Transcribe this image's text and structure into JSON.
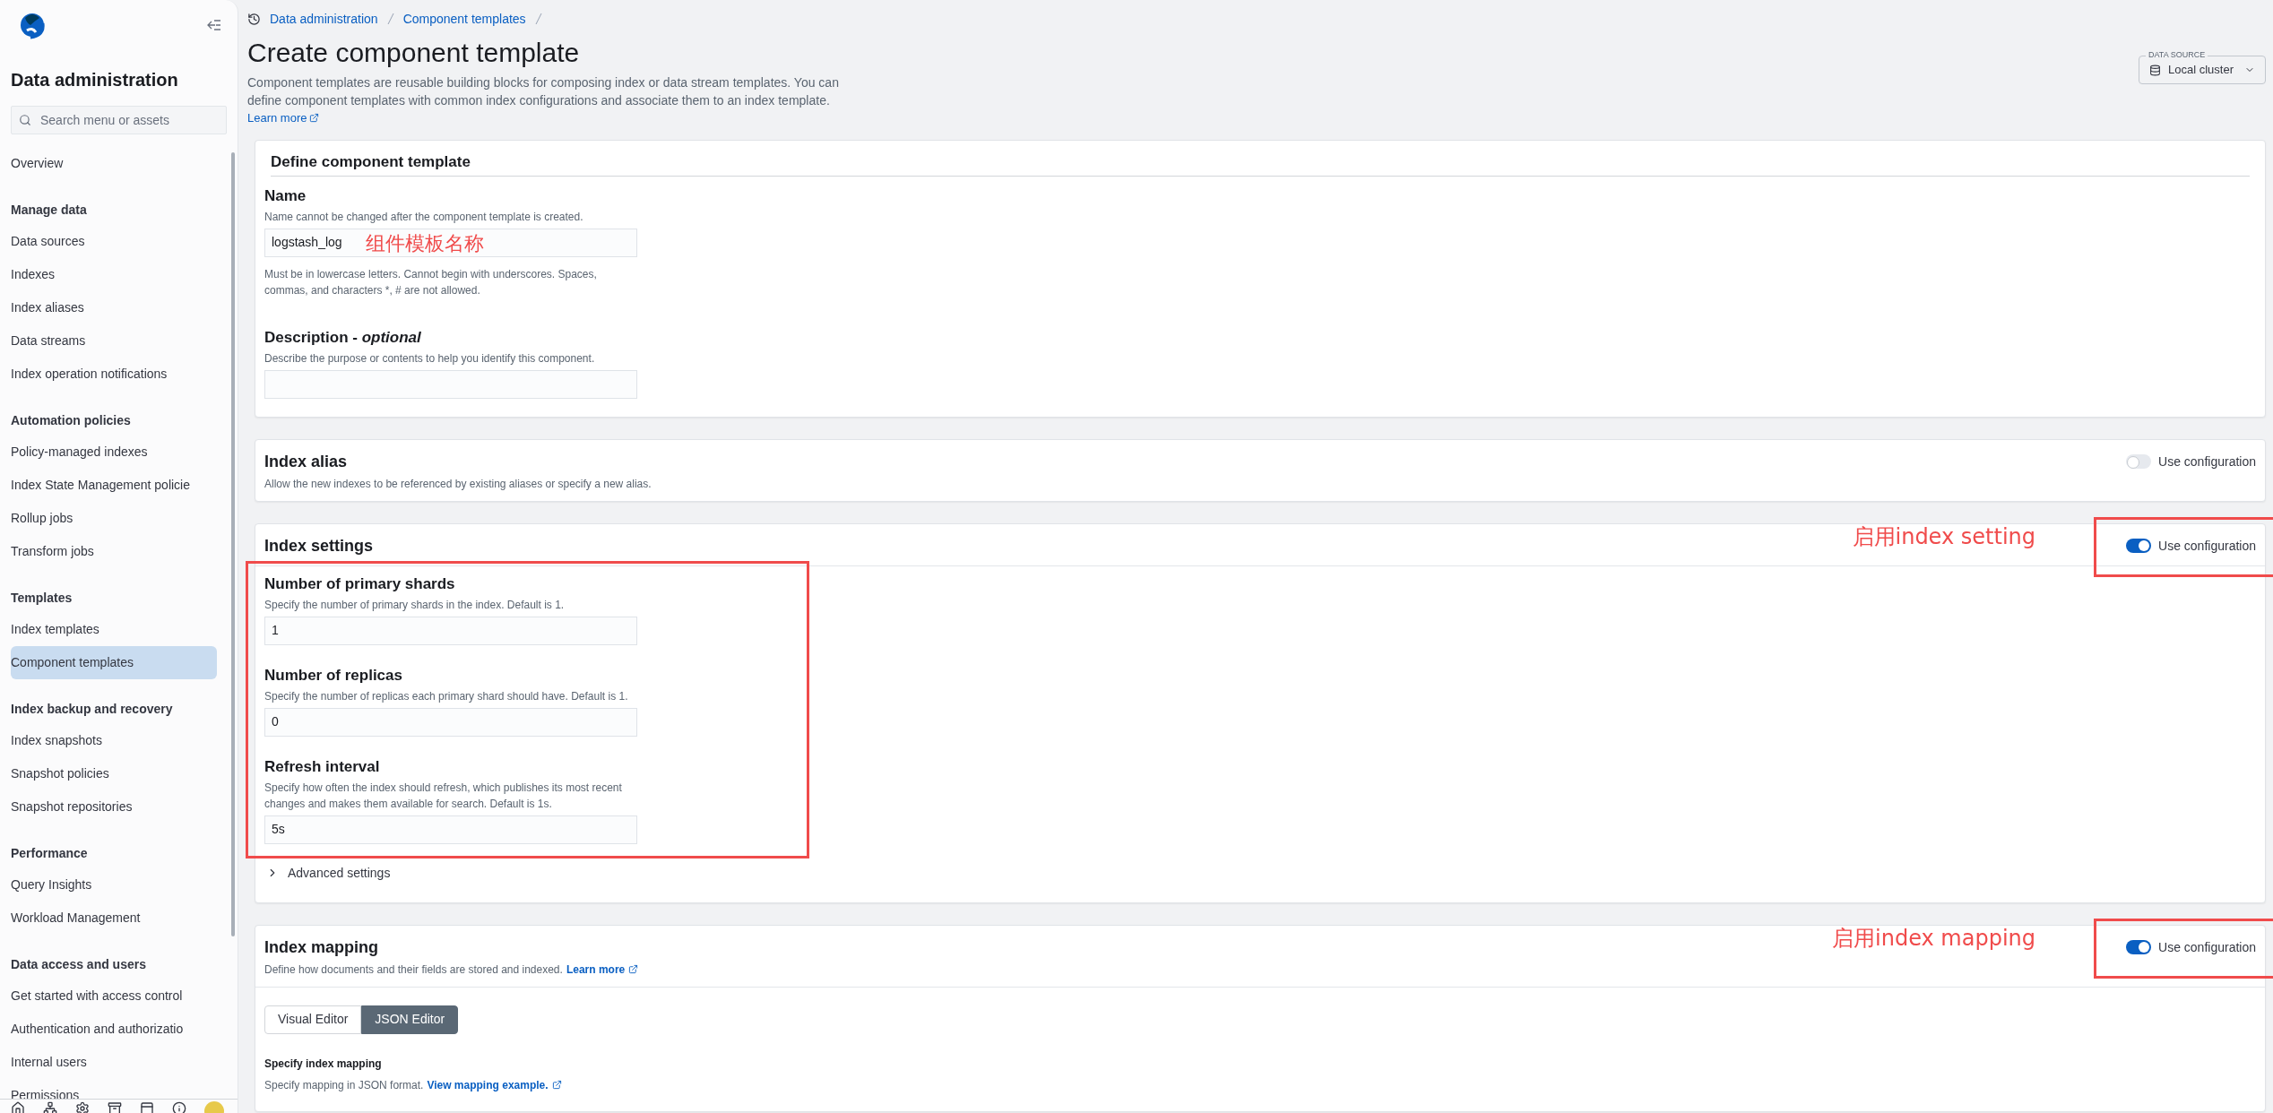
{
  "sidebar": {
    "title": "Data administration",
    "search": {
      "placeholder": "Search menu or assets"
    },
    "sections": [
      {
        "items": [
          {
            "label": "Overview",
            "selected": false
          }
        ]
      },
      {
        "heading": "Manage data",
        "items": [
          {
            "label": "Data sources",
            "selected": false
          },
          {
            "label": "Indexes",
            "selected": false
          },
          {
            "label": "Index aliases",
            "selected": false
          },
          {
            "label": "Data streams",
            "selected": false
          },
          {
            "label": "Index operation notifications",
            "selected": false
          }
        ]
      },
      {
        "heading": "Automation policies",
        "items": [
          {
            "label": "Policy-managed indexes",
            "selected": false
          },
          {
            "label": "Index State Management policie",
            "selected": false
          },
          {
            "label": "Rollup jobs",
            "selected": false
          },
          {
            "label": "Transform jobs",
            "selected": false
          }
        ]
      },
      {
        "heading": "Templates",
        "items": [
          {
            "label": "Index templates",
            "selected": false
          },
          {
            "label": "Component templates",
            "selected": true
          }
        ]
      },
      {
        "heading": "Index backup and recovery",
        "items": [
          {
            "label": "Index snapshots",
            "selected": false
          },
          {
            "label": "Snapshot policies",
            "selected": false
          },
          {
            "label": "Snapshot repositories",
            "selected": false
          }
        ]
      },
      {
        "heading": "Performance",
        "items": [
          {
            "label": "Query Insights",
            "selected": false
          },
          {
            "label": "Workload Management",
            "selected": false
          }
        ]
      },
      {
        "heading": "Data access and users",
        "items": [
          {
            "label": "Get started with access control",
            "selected": false
          },
          {
            "label": "Authentication and authorizatio",
            "selected": false
          },
          {
            "label": "Internal users",
            "selected": false
          },
          {
            "label": "Permissions",
            "selected": false
          }
        ]
      }
    ]
  },
  "breadcrumbs": [
    "Data administration",
    "Component templates"
  ],
  "page": {
    "title": "Create component template",
    "description": "Component templates are reusable building blocks for composing index or data stream templates. You can define component templates with common index configurations and associate them to an index template.",
    "learn_more": "Learn more"
  },
  "data_source": {
    "label": "DATA SOURCE",
    "value": "Local cluster"
  },
  "panels": [
    {
      "kind": "define",
      "title": "Define component template",
      "fields": [
        {
          "label": "Name",
          "help": "Name cannot be changed after the component template is created.",
          "value": "logstash_log",
          "note": "组件模板名称",
          "hint": "Must be in lowercase letters. Cannot begin with underscores. Spaces, commas, and characters *, # are not allowed."
        },
        {
          "label": "Description - *optional*",
          "help": "Describe the purpose or contents to help you identify this component."
        }
      ]
    },
    {
      "kind": "alias",
      "title": "Index alias",
      "description": "Allow the new indexes to be referenced by existing aliases or specify a new alias.",
      "toggle": {
        "label": "Use configuration",
        "on": false
      }
    },
    {
      "kind": "settings",
      "title": "Index settings",
      "note": "启用index setting",
      "toggle": {
        "label": "Use configuration",
        "on": true,
        "highlighted": true
      },
      "fields_highlighted": true,
      "fields": [
        {
          "label": "Number of primary shards",
          "help": "Specify the number of primary shards in the index. Default is 1.",
          "value": "1"
        },
        {
          "label": "Number of replicas",
          "help": "Specify the number of replicas each primary shard should have. Default is 1.",
          "value": "0"
        },
        {
          "label": "Refresh interval",
          "help": "Specify how often the index should refresh, which publishes its most recent changes and makes them available for search. Default is 1s.",
          "value": "5s"
        }
      ],
      "advanced": {
        "label": "Advanced settings",
        "expanded": false
      }
    },
    {
      "kind": "mapping",
      "title": "Index mapping",
      "description": "Define how documents and their fields are stored and indexed.",
      "link": "Learn more",
      "note": "启用index mapping",
      "toggle": {
        "label": "Use configuration",
        "on": true,
        "highlighted": true
      },
      "editor": {
        "tabs": [
          {
            "label": "Visual Editor",
            "selected": false
          },
          {
            "label": "JSON Editor",
            "selected": true
          }
        ],
        "heading": "Specify index mapping",
        "text": "Specify mapping in JSON format.",
        "link": "View mapping example."
      }
    }
  ]
}
